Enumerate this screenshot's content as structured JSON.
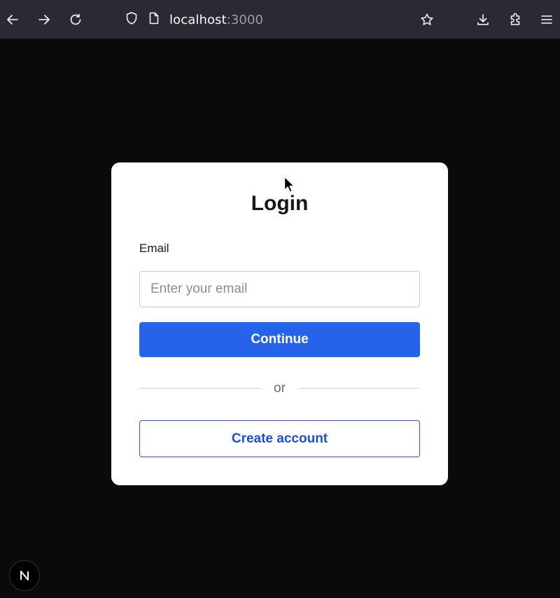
{
  "browser": {
    "url_host": "localhost",
    "url_port": ":3000",
    "icons": [
      "back-arrow-icon",
      "forward-arrow-icon",
      "reload-icon",
      "shield-icon",
      "page-icon",
      "star-icon",
      "download-icon",
      "extensions-icon",
      "menu-icon"
    ]
  },
  "login": {
    "title": "Login",
    "email_label": "Email",
    "email_placeholder": "Enter your email",
    "email_value": "",
    "continue_label": "Continue",
    "divider_text": "or",
    "create_account_label": "Create account"
  },
  "badge": {
    "letter": "N"
  },
  "colors": {
    "primary": "#2563eb",
    "outline": "#1d4ed8",
    "page_bg": "#0a0a0a",
    "toolbar_bg": "#2b2a33"
  }
}
